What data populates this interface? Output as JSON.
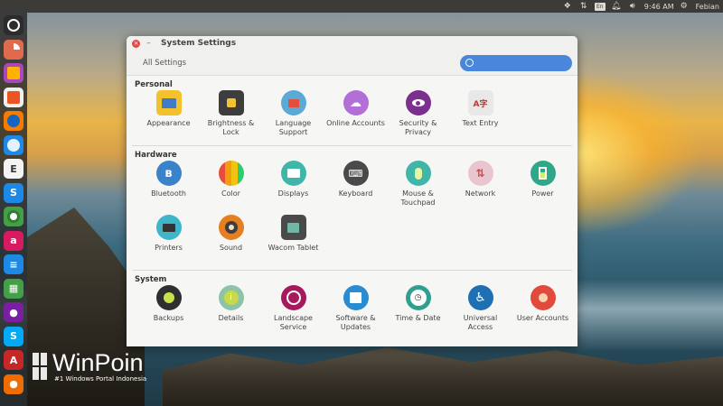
{
  "top_panel": {
    "language": "En",
    "time": "9:46 AM",
    "user": "Febian"
  },
  "window": {
    "title": "System Settings",
    "all_settings": "All Settings",
    "search_placeholder": ""
  },
  "sections": {
    "personal": {
      "title": "Personal",
      "items": [
        {
          "label": "Appearance"
        },
        {
          "label": "Brightness & Lock"
        },
        {
          "label": "Language Support"
        },
        {
          "label": "Online Accounts"
        },
        {
          "label": "Security & Privacy"
        },
        {
          "label": "Text Entry"
        }
      ]
    },
    "hardware": {
      "title": "Hardware",
      "items": [
        {
          "label": "Bluetooth"
        },
        {
          "label": "Color"
        },
        {
          "label": "Displays"
        },
        {
          "label": "Keyboard"
        },
        {
          "label": "Mouse & Touchpad"
        },
        {
          "label": "Network"
        },
        {
          "label": "Power"
        },
        {
          "label": "Printers"
        },
        {
          "label": "Sound"
        },
        {
          "label": "Wacom Tablet"
        }
      ]
    },
    "system": {
      "title": "System",
      "items": [
        {
          "label": "Backups"
        },
        {
          "label": "Details"
        },
        {
          "label": "Landscape Service"
        },
        {
          "label": "Software & Updates"
        },
        {
          "label": "Time & Date"
        },
        {
          "label": "Universal Access"
        },
        {
          "label": "User Accounts"
        }
      ]
    }
  },
  "watermark": {
    "brand": "WinPoin",
    "tagline": "#1 Windows Portal Indonesia"
  }
}
